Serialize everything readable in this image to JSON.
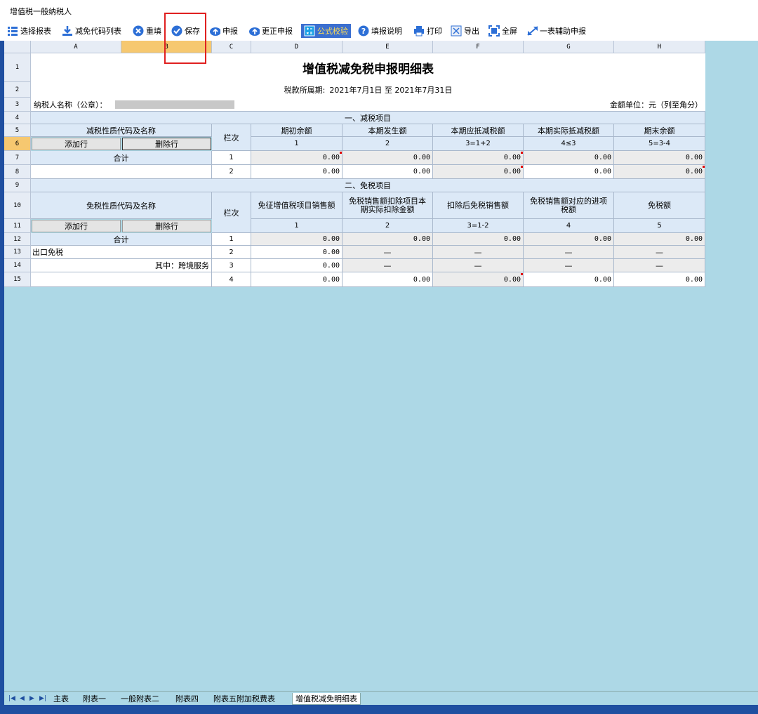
{
  "window": {
    "title": "增值税一般纳税人"
  },
  "toolbar": {
    "items": [
      {
        "label": "选择报表",
        "icon": "list-icon"
      },
      {
        "label": "减免代码列表",
        "icon": "download-icon"
      },
      {
        "label": "重填",
        "icon": "close-circle-icon"
      },
      {
        "label": "保存",
        "icon": "check-circle-icon"
      },
      {
        "label": "申报",
        "icon": "cloud-upload-icon"
      },
      {
        "label": "更正申报",
        "icon": "cloud-upload-icon"
      },
      {
        "label": "公式校验",
        "icon": "calculator-icon"
      },
      {
        "label": "填报说明",
        "icon": "help-circle-icon"
      },
      {
        "label": "打印",
        "icon": "printer-icon"
      },
      {
        "label": "导出",
        "icon": "excel-icon"
      },
      {
        "label": "全屏",
        "icon": "fullscreen-icon"
      },
      {
        "label": "一表辅助申报",
        "icon": "expand-arrows-icon"
      }
    ]
  },
  "sheet": {
    "columns": [
      "A",
      "B",
      "C",
      "D",
      "E",
      "F",
      "G",
      "H"
    ],
    "rows": [
      "1",
      "2",
      "3",
      "4",
      "5",
      "6",
      "7",
      "8",
      "9",
      "10",
      "11",
      "12",
      "13",
      "14",
      "15"
    ],
    "title": "增值税减免税申报明细表",
    "period_label": "税款所属期:",
    "period_value": "2021年7月1日 至 2021年7月31日",
    "taxpayer_label": "纳税人名称（公章）：",
    "unit_label": "金额单位：元（列至角分）",
    "section1": {
      "title": "一、减税项目",
      "name_header": "减税性质代码及名称",
      "line_header": "栏次",
      "col_headers": [
        "期初余额",
        "本期发生额",
        "本期应抵减税额",
        "本期实际抵减税额",
        "期末余额"
      ],
      "col_nums": [
        "1",
        "2",
        "3=1+2",
        "4≤3",
        "5=3-4"
      ],
      "add_row": "添加行",
      "delete_row": "删除行",
      "rows": [
        {
          "name": "合计",
          "line": "1",
          "values": [
            "0.00",
            "0.00",
            "0.00",
            "0.00",
            "0.00"
          ]
        },
        {
          "name": "",
          "line": "2",
          "values": [
            "0.00",
            "0.00",
            "0.00",
            "0.00",
            "0.00"
          ]
        }
      ]
    },
    "section2": {
      "title": "二、免税项目",
      "name_header": "免税性质代码及名称",
      "line_header": "栏次",
      "col_headers": [
        "免征增值税项目销售额",
        "免税销售额扣除项目本期实际扣除金额",
        "扣除后免税销售额",
        "免税销售额对应的进项税额",
        "免税额"
      ],
      "col_nums": [
        "1",
        "2",
        "3=1-2",
        "4",
        "5"
      ],
      "add_row": "添加行",
      "delete_row": "删除行",
      "rows": [
        {
          "name": "合计",
          "line": "1",
          "values": [
            "0.00",
            "0.00",
            "0.00",
            "0.00",
            "0.00"
          ]
        },
        {
          "name": "出口免税",
          "line": "2",
          "values": [
            "0.00",
            "—",
            "—",
            "—",
            "—"
          ]
        },
        {
          "name": "其中：跨境服务",
          "line": "3",
          "values": [
            "0.00",
            "—",
            "—",
            "—",
            "—"
          ]
        },
        {
          "name": "",
          "line": "4",
          "values": [
            "0.00",
            "0.00",
            "0.00",
            "0.00",
            "0.00"
          ]
        }
      ]
    }
  },
  "tabs": [
    "主表",
    "附表一",
    "一般附表二",
    "附表四",
    "附表五附加税费表",
    "增值税减免明细表"
  ],
  "active_tab": "增值税减免明细表",
  "colors": {
    "accent": "#3b6fd0",
    "header_fill": "#dce9f7",
    "sheet_bg": "#add8e6",
    "highlight": "#e02020"
  }
}
